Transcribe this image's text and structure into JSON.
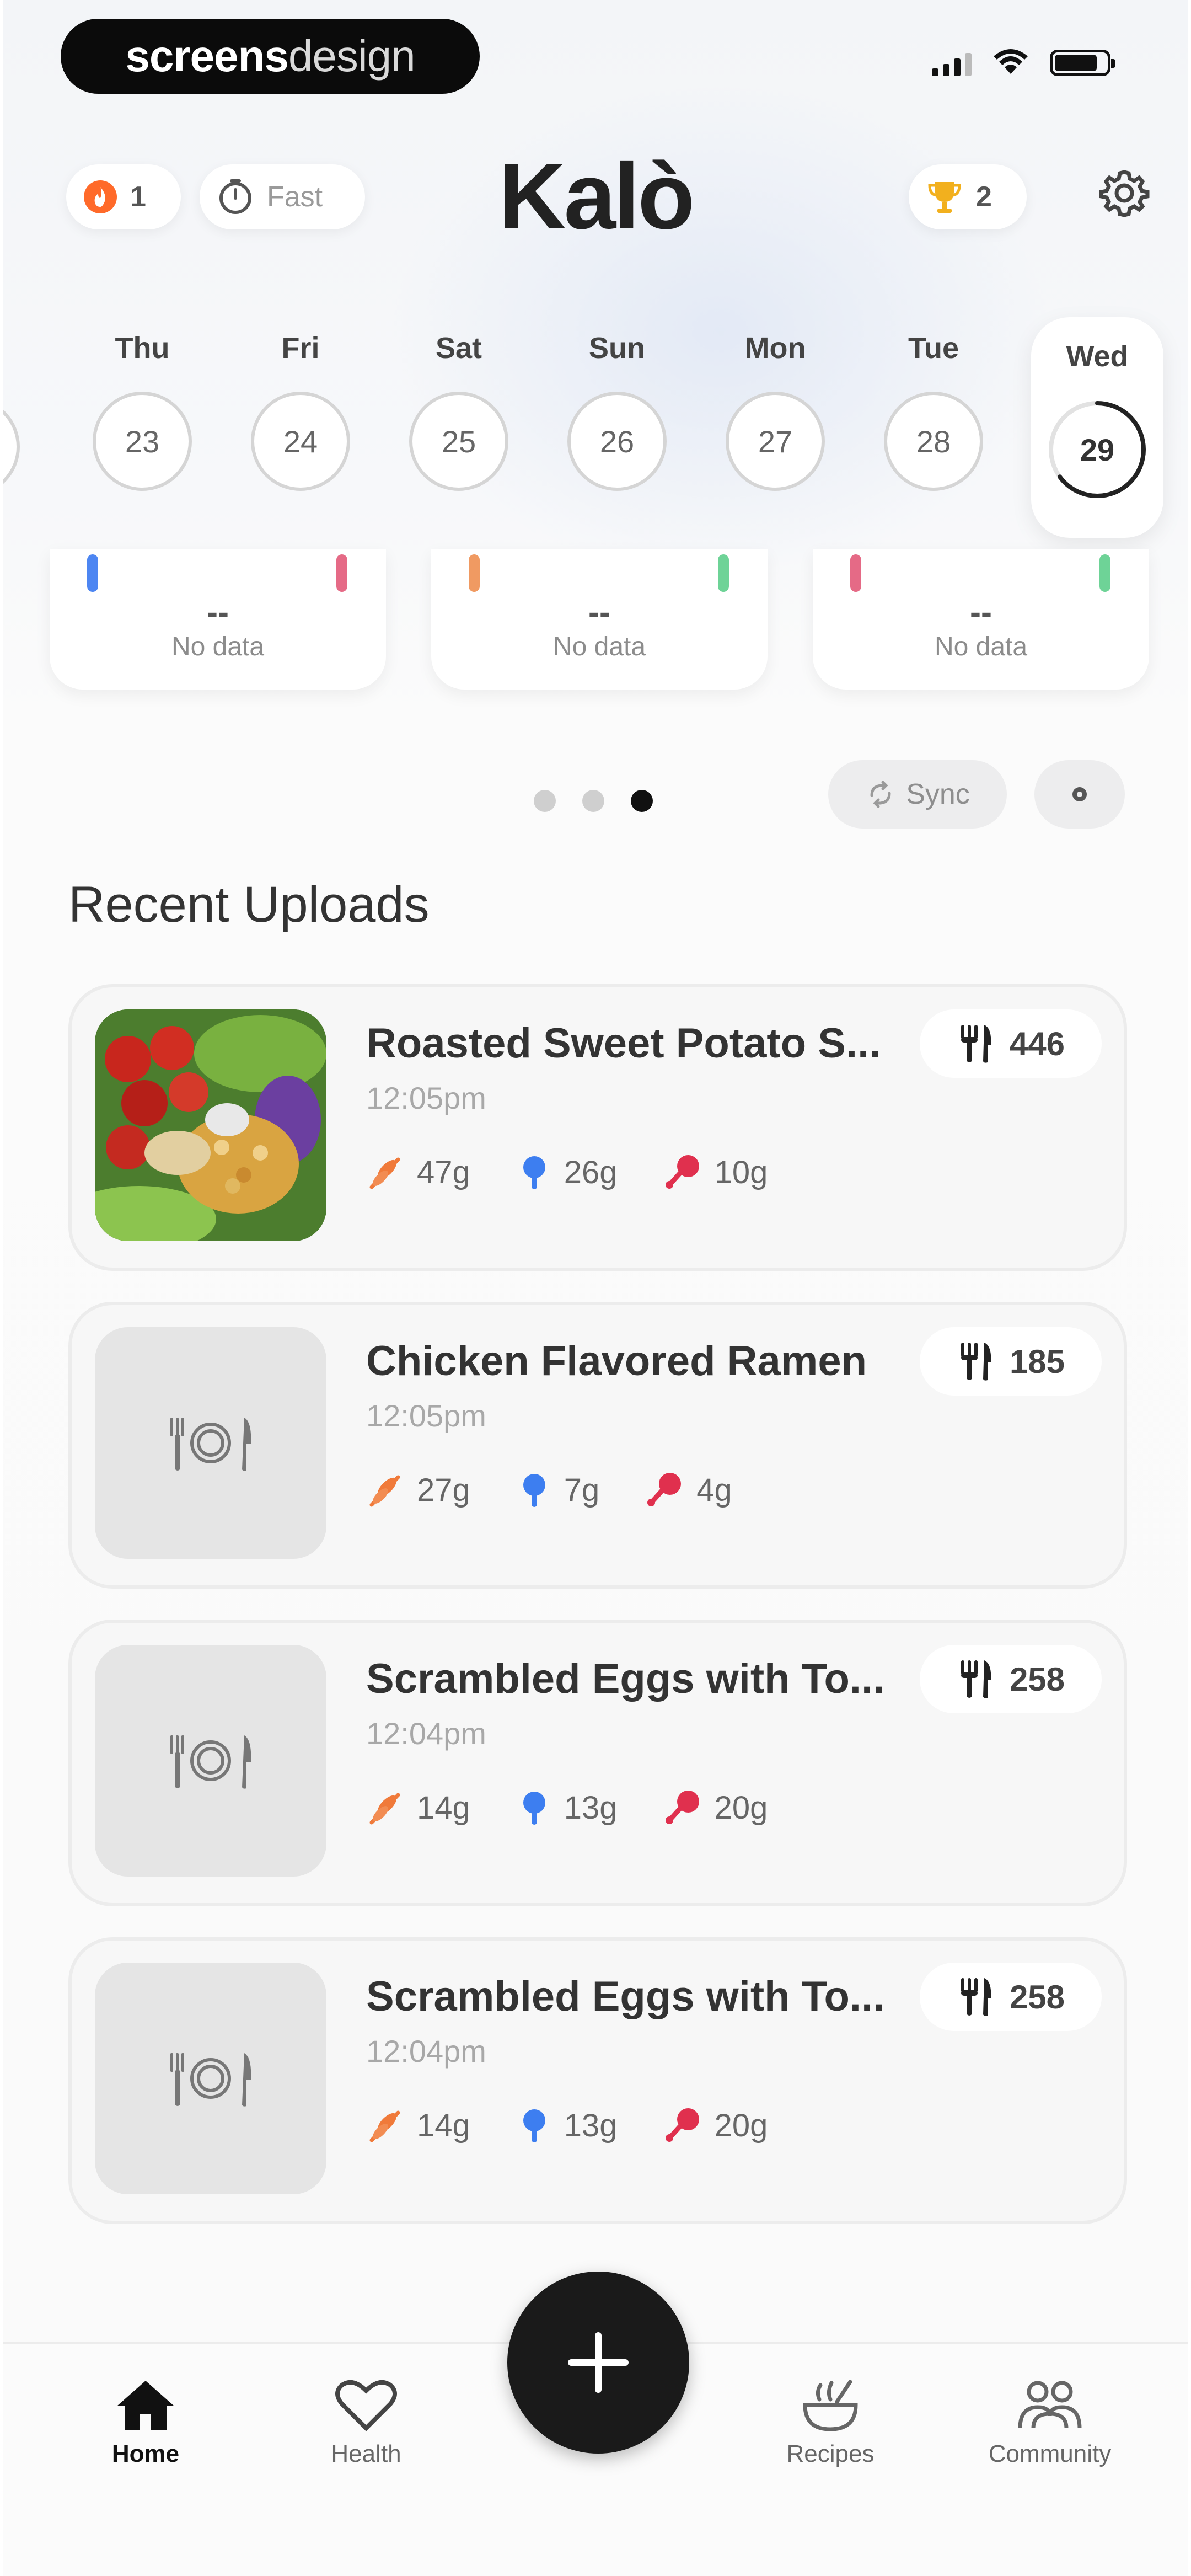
{
  "watermark": {
    "part1": "screens",
    "part2": "design"
  },
  "header": {
    "streak_count": "1",
    "fast_label": "Fast",
    "logo": "Kalò",
    "trophy_count": "2"
  },
  "week": [
    {
      "label": "Thu",
      "date": "23"
    },
    {
      "label": "Fri",
      "date": "24"
    },
    {
      "label": "Sat",
      "date": "25"
    },
    {
      "label": "Sun",
      "date": "26"
    },
    {
      "label": "Mon",
      "date": "27"
    },
    {
      "label": "Tue",
      "date": "28"
    },
    {
      "label": "Wed",
      "date": "29",
      "progress": 0.65
    }
  ],
  "summary_cards": [
    {
      "value": "--",
      "label": "No data"
    },
    {
      "value": "--",
      "label": "No data"
    },
    {
      "value": "--",
      "label": "No data"
    }
  ],
  "carousel": {
    "pages": 3,
    "active_page": 3
  },
  "sync_label": "Sync",
  "recent": {
    "title": "Recent Uploads",
    "items": [
      {
        "name": "Roasted Sweet Potato S...",
        "time": "12:05pm",
        "carbs": "47g",
        "protein": "26g",
        "fat": "10g",
        "calories": "446",
        "has_photo": true
      },
      {
        "name": "Chicken Flavored Ramen",
        "time": "12:05pm",
        "carbs": "27g",
        "protein": "7g",
        "fat": "4g",
        "calories": "185",
        "has_photo": false
      },
      {
        "name": "Scrambled Eggs with To...",
        "time": "12:04pm",
        "carbs": "14g",
        "protein": "13g",
        "fat": "20g",
        "calories": "258",
        "has_photo": false
      },
      {
        "name": "Scrambled Eggs with To...",
        "time": "12:04pm",
        "carbs": "14g",
        "protein": "13g",
        "fat": "20g",
        "calories": "258",
        "has_photo": false
      }
    ]
  },
  "nav": {
    "home": "Home",
    "health": "Health",
    "recipes": "Recipes",
    "community": "Community"
  },
  "colors": {
    "carbs": "#f07a3a",
    "protein": "#3d7ef0",
    "fat": "#e0304e",
    "accent_dark": "#1a1a1a"
  }
}
